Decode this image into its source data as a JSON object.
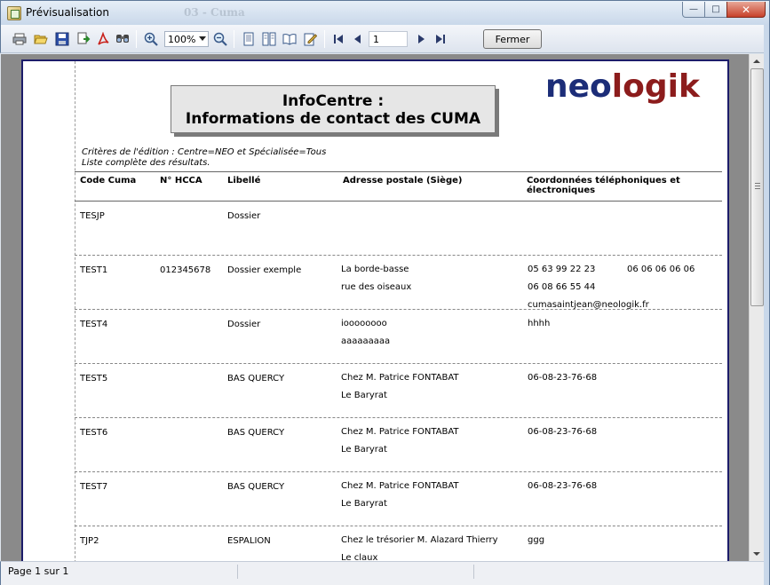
{
  "window": {
    "title": "Prévisualisation",
    "ghost_title": "03 - Cuma"
  },
  "toolbar": {
    "zoom": "100%",
    "page_number": "1",
    "close_label": "Fermer",
    "icons": [
      "print-icon",
      "open-icon",
      "save-icon",
      "export-icon",
      "pdf-icon",
      "find-icon",
      "zoom-in-icon",
      "zoom-out-icon",
      "single-page-icon",
      "multi-page-icon",
      "book-icon",
      "edit-icon",
      "first-page-icon",
      "prev-page-icon",
      "next-page-icon",
      "last-page-icon"
    ]
  },
  "report": {
    "logo_part1": "neo",
    "logo_part2": "logik",
    "title_line1": "InfoCentre :",
    "title_line2": "Informations de contact des CUMA",
    "criteria_line1": "Critères de l'édition : Centre=NEO et Spécialisée=Tous",
    "criteria_line2": "Liste complète des résultats.",
    "headers": {
      "code": "Code Cuma",
      "hcca": "N° HCCA",
      "libelle": "Libellé",
      "adresse": "Adresse postale (Siège)",
      "coord_line1": "Coordonnées téléphoniques et",
      "coord_line2": "électroniques"
    },
    "rows": [
      {
        "code": "TESJP",
        "hcca": "",
        "libelle": "Dossier",
        "addr1": "",
        "addr2": "",
        "tel1": "",
        "tel1b": "",
        "tel2": "",
        "email": ""
      },
      {
        "code": "TEST1",
        "hcca": "012345678",
        "libelle": "Dossier exemple",
        "addr1": "La borde-basse",
        "addr2": "rue des oiseaux",
        "tel1": "05 63 99 22 23",
        "tel1b": "06 06 06 06 06",
        "tel2": "06 08 66 55 44",
        "email": "cumasaintjean@neologik.fr"
      },
      {
        "code": "TEST4",
        "hcca": "",
        "libelle": "Dossier",
        "addr1": "ioooooooo",
        "addr2": "aaaaaaaaa",
        "tel1": "hhhh",
        "tel1b": "",
        "tel2": "",
        "email": ""
      },
      {
        "code": "TEST5",
        "hcca": "",
        "libelle": "BAS QUERCY",
        "addr1": "Chez M. Patrice FONTABAT",
        "addr2": "Le Baryrat",
        "tel1": "06-08-23-76-68",
        "tel1b": "",
        "tel2": "",
        "email": ""
      },
      {
        "code": "TEST6",
        "hcca": "",
        "libelle": "BAS QUERCY",
        "addr1": "Chez M. Patrice FONTABAT",
        "addr2": "Le Baryrat",
        "tel1": "06-08-23-76-68",
        "tel1b": "",
        "tel2": "",
        "email": ""
      },
      {
        "code": "TEST7",
        "hcca": "",
        "libelle": "BAS QUERCY",
        "addr1": "Chez M. Patrice FONTABAT",
        "addr2": "Le Baryrat",
        "tel1": "06-08-23-76-68",
        "tel1b": "",
        "tel2": "",
        "email": ""
      },
      {
        "code": "TJP2",
        "hcca": "",
        "libelle": "ESPALION",
        "addr1": "Chez le trésorier M. Alazard Thierry",
        "addr2": "Le claux",
        "tel1": "ggg",
        "tel1b": "",
        "tel2": "",
        "email": ""
      }
    ]
  },
  "status": {
    "page_info": "Page 1 sur 1"
  }
}
